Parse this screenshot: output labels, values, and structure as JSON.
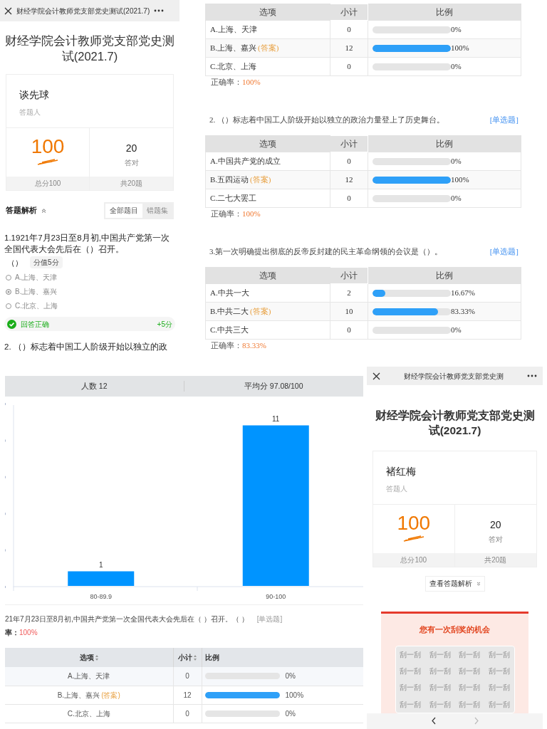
{
  "quiz_panel": {
    "header_title": "财经学院会计教师党支部党史测试(2021.7)",
    "title": "财经学院会计教师党支部党史测试(2021.7)",
    "respondent": {
      "name": "谈先球",
      "label": "答题人"
    },
    "score": {
      "value": "100",
      "footer": "总分100"
    },
    "correct": {
      "value": "20",
      "label": "答对",
      "footer": "共20题"
    },
    "analysis": {
      "heading": "答题解析",
      "expanded": true,
      "tabs": [
        {
          "label": "全部题目",
          "selected": true
        },
        {
          "label": "错题集",
          "selected": false
        }
      ]
    },
    "question": {
      "text": "1.1921年7月23日至8月初,中国共产党第一次全国代表大会先后在（）召开。",
      "blank": "（）",
      "points": "分值5分",
      "options": [
        {
          "label": "A.上海、天津",
          "selected": false
        },
        {
          "label": "B.上海、嘉兴",
          "selected": true
        },
        {
          "label": "C.北京、上海",
          "selected": false
        }
      ],
      "result": {
        "text": "回答正确",
        "points": "+5分"
      }
    },
    "next_question": "2. （）标志着中国工人阶级开始以独立的政"
  },
  "stats_panel": {
    "tables": [
      {
        "columns": [
          "选项",
          "小计",
          "比例"
        ],
        "rows": [
          {
            "option": "A.上海、天津",
            "count": "0",
            "level": 0,
            "percent": "0%"
          },
          {
            "option": "B.上海、嘉兴",
            "answer_tag": "(答案)",
            "count": "12",
            "level": 1,
            "percent": "100%"
          },
          {
            "option": "C.北京、上海",
            "count": "0",
            "level": 0,
            "percent": "0%"
          }
        ],
        "accuracy_label": "正确率：",
        "accuracy": "100%"
      },
      {
        "question": "2. （）标志着中国工人阶级开始以独立的政治力量登上了历史舞台。",
        "type_tag": "[单选题]",
        "columns": [
          "选项",
          "小计",
          "比例"
        ],
        "rows": [
          {
            "option": "A.中国共产党的成立",
            "count": "0",
            "level": 0,
            "percent": "0%"
          },
          {
            "option": "B.五四运动",
            "answer_tag": "(答案)",
            "count": "12",
            "level": 1,
            "percent": "100%"
          },
          {
            "option": "C.二七大罢工",
            "count": "0",
            "level": 0,
            "percent": "0%"
          }
        ],
        "accuracy_label": "正确率：",
        "accuracy": "100%"
      },
      {
        "question": "3.第一次明确提出彻底的反帝反封建的民主革命纲领的会议是（）。",
        "type_tag": "[单选题]",
        "columns": [
          "选项",
          "小计",
          "比例"
        ],
        "rows": [
          {
            "option": "A.中共一大",
            "count": "2",
            "level": 0.1667,
            "percent": "16.67%"
          },
          {
            "option": "B.中共二大",
            "answer_tag": "(答案)",
            "count": "10",
            "level": 0.8333,
            "percent": "83.33%"
          },
          {
            "option": "C.中共三大",
            "count": "0",
            "level": 0,
            "percent": "0%"
          }
        ],
        "accuracy_label": "正确率：",
        "accuracy": "83.33%"
      }
    ]
  },
  "report_panel": {
    "count": "人数 12",
    "average": "平均分 97.08/100",
    "chart_data": {
      "type": "bar",
      "categories": [
        "80-89.9",
        "90-100"
      ],
      "series": [
        {
          "color": "#0094ff",
          "values": [
            1,
            11
          ]
        }
      ],
      "data_labels": true
    },
    "question": "21年7月23日至8月初,中国共产党第一次全国代表大会先后在（ ）召开。（ ）",
    "type_tag": "[单选题]",
    "accuracy_label": "率：",
    "accuracy": "100%",
    "columns": [
      {
        "label": "选项",
        "sortable": true
      },
      {
        "label": "小计",
        "sortable": true
      },
      {
        "label": "比例",
        "sortable": false
      }
    ],
    "rows": [
      {
        "option": "A.上海、天津",
        "count": "0",
        "level": 0,
        "percent": "0%"
      },
      {
        "option": "B.上海、嘉兴",
        "answer_tag": "(答案)",
        "count": "12",
        "level": 1,
        "percent": "100%"
      },
      {
        "option": "C.北京、上海",
        "count": "0",
        "level": 0,
        "percent": "0%"
      }
    ]
  },
  "result_panel": {
    "header_title": "财经学院会计教师党支部党史测",
    "title": "财经学院会计教师党支部党史测试(2021.7)",
    "respondent": {
      "name": "褚红梅",
      "label": "答题人"
    },
    "score": {
      "value": "100",
      "footer": "总分100"
    },
    "correct": {
      "value": "20",
      "label": "答对",
      "footer": "共20题"
    },
    "analysis_button": "查看答题解析",
    "prize": {
      "heading": "您有一次刮奖的机会",
      "scratch_labels": [
        "刮一刮",
        "刮一刮",
        "刮一刮",
        "刮一刮",
        "刮一刮",
        "刮一刮",
        "刮一刮",
        "刮一刮",
        "刮一刮",
        "刮一刮",
        "刮一刮",
        "刮一刮",
        "刮一刮",
        "刮一刮",
        "刮一刮",
        "刮一刮"
      ]
    }
  }
}
